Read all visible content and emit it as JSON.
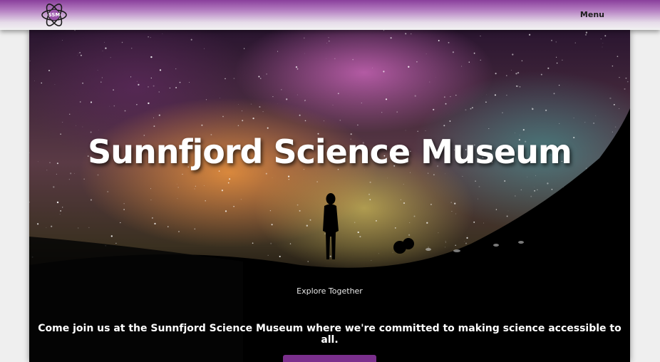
{
  "header": {
    "logo_text": "SSM",
    "menu_label": "Menu"
  },
  "hero": {
    "title": "Sunnfjord Science Museum",
    "tagline": "Explore Together",
    "lead": "Come join us at the Sunnfjord Science Museum where we're committed to making science accessible to all.",
    "cta_label": ""
  },
  "colors": {
    "brand_purple": "#8a3f9c",
    "cta_purple": "#7a2f8c",
    "page_background": "#efefef"
  }
}
